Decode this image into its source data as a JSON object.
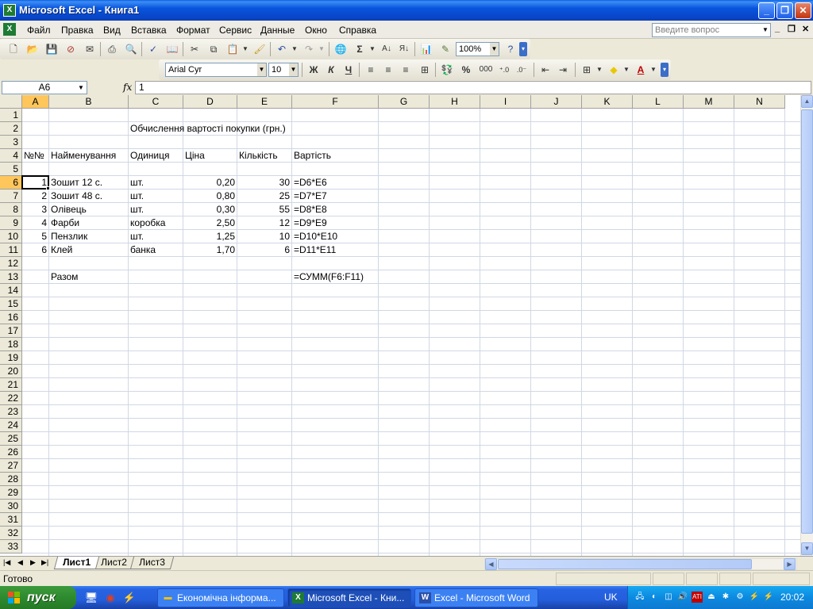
{
  "window": {
    "title": "Microsoft Excel - Книга1"
  },
  "menu": {
    "items": [
      "Файл",
      "Правка",
      "Вид",
      "Вставка",
      "Формат",
      "Сервис",
      "Данные",
      "Окно",
      "Справка"
    ],
    "ask_placeholder": "Введите вопрос"
  },
  "toolbar": {
    "zoom": "100%",
    "font_name": "Arial Cyr",
    "font_size": "10",
    "bold": "Ж",
    "italic": "К",
    "underline": "Ч",
    "percent": "%",
    "thousands": "000",
    "sum": "Σ"
  },
  "formula_bar": {
    "name_box": "A6",
    "fx": "fx",
    "value": "1"
  },
  "grid": {
    "columns": [
      "A",
      "B",
      "C",
      "D",
      "E",
      "F",
      "G",
      "H",
      "I",
      "J",
      "K",
      "L",
      "M",
      "N"
    ],
    "rows": [
      "1",
      "2",
      "3",
      "4",
      "5",
      "6",
      "7",
      "8",
      "9",
      "10",
      "11",
      "12",
      "13",
      "14",
      "15",
      "16",
      "17",
      "18",
      "19",
      "20",
      "21",
      "22",
      "23",
      "24",
      "25",
      "26",
      "27",
      "28",
      "29",
      "30",
      "31",
      "32",
      "33"
    ],
    "selected_cell": "A6",
    "title": "Обчислення вартості покупки (грн.)",
    "headers": [
      "№№",
      "Найменування",
      "Одиниця",
      "Ціна",
      "Кількість",
      "Вартість"
    ],
    "items": [
      {
        "n": "1",
        "name": "Зошит 12 с.",
        "unit": "шт.",
        "price": "0,20",
        "qty": "30",
        "formula": "=D6*E6"
      },
      {
        "n": "2",
        "name": "Зошит 48 с.",
        "unit": "шт.",
        "price": "0,80",
        "qty": "25",
        "formula": "=D7*E7"
      },
      {
        "n": "3",
        "name": "Олівець",
        "unit": "шт.",
        "price": "0,30",
        "qty": "55",
        "formula": "=D8*E8"
      },
      {
        "n": "4",
        "name": "Фарби",
        "unit": "коробка",
        "price": "2,50",
        "qty": "12",
        "formula": "=D9*E9"
      },
      {
        "n": "5",
        "name": "Пензлик",
        "unit": "шт.",
        "price": "1,25",
        "qty": "10",
        "formula": "=D10*E10"
      },
      {
        "n": "6",
        "name": "Клей",
        "unit": "банка",
        "price": "1,70",
        "qty": "6",
        "formula": "=D11*E11"
      }
    ],
    "total_label": "Разом",
    "total_formula": "=СУММ(F6:F11)"
  },
  "sheets": [
    "Лист1",
    "Лист2",
    "Лист3"
  ],
  "active_sheet": "Лист1",
  "status": "Готово",
  "taskbar": {
    "start": "пуск",
    "buttons": [
      "Економічна інформа...",
      "Microsoft Excel - Кни...",
      "Excel - Microsoft Word"
    ],
    "active_button": "Microsoft Excel - Кни...",
    "language": "UK",
    "clock": "20:02"
  },
  "colors": {
    "title_bar": "#0855DD",
    "selected_header": "#FFC65C",
    "gridline": "#D0D7E5",
    "start_button": "#2E8A2E",
    "taskbar": "#245EDC"
  }
}
